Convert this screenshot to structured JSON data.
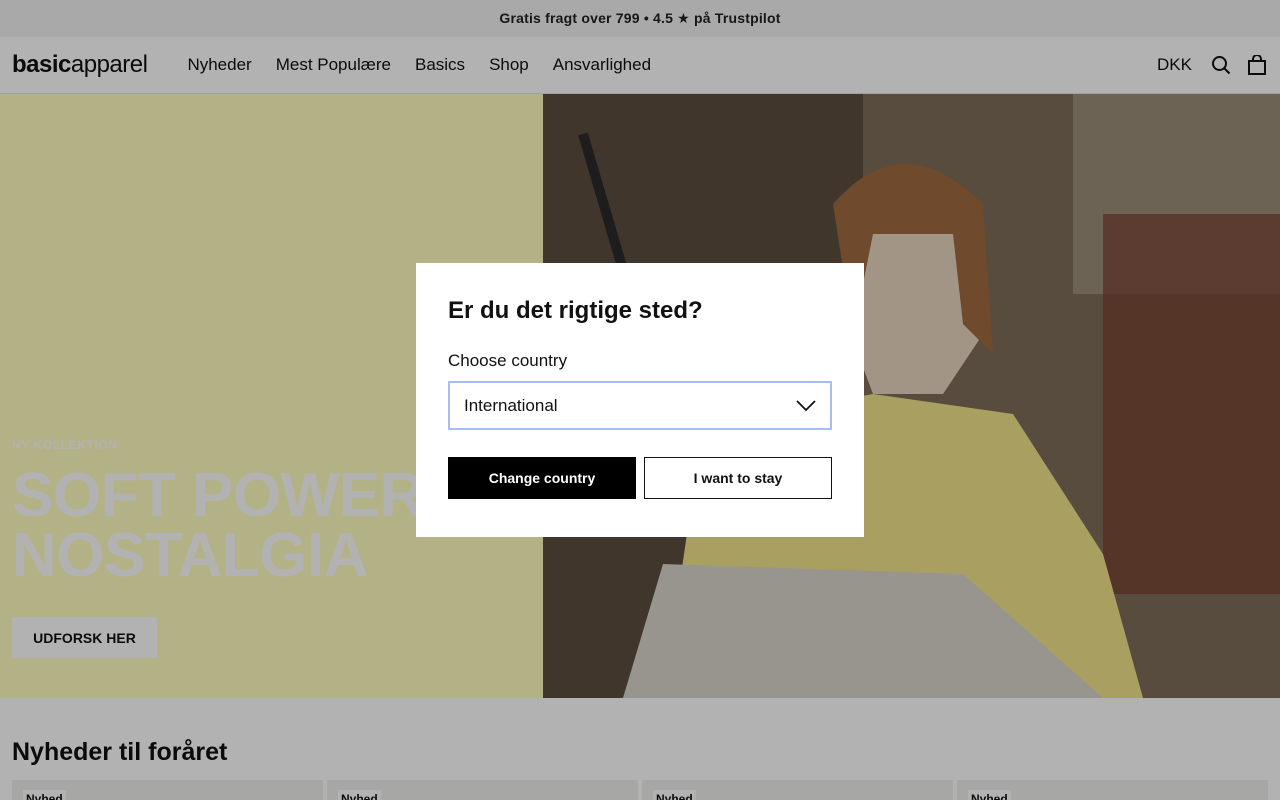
{
  "announcement": "Gratis fragt over 799 • 4.5 ★ på Trustpilot",
  "header": {
    "logo_bold": "basic",
    "logo_light": "apparel",
    "nav": [
      "Nyheder",
      "Mest Populære",
      "Basics",
      "Shop",
      "Ansvarlighed"
    ],
    "currency": "DKK"
  },
  "hero": {
    "eyebrow": "NY KOLLEKTION",
    "headline_line1": "SOFT POWER",
    "headline_line2": "NOSTALGIA",
    "cta": "UDFORSK HER"
  },
  "section": {
    "title": "Nyheder til foråret",
    "badges": [
      "Nyhed",
      "Nyhed",
      "Nyhed",
      "Nyhed"
    ]
  },
  "modal": {
    "title": "Er du det rigtige sted?",
    "label": "Choose country",
    "selected": "International",
    "change_btn": "Change country",
    "stay_btn": "I want to stay"
  },
  "colors": {
    "hero_bg": "#ffffc0",
    "select_border": "#a9bdf2",
    "primary_btn": "#000000"
  },
  "icons": [
    "search-icon",
    "bag-icon",
    "chevron-down-icon"
  ]
}
